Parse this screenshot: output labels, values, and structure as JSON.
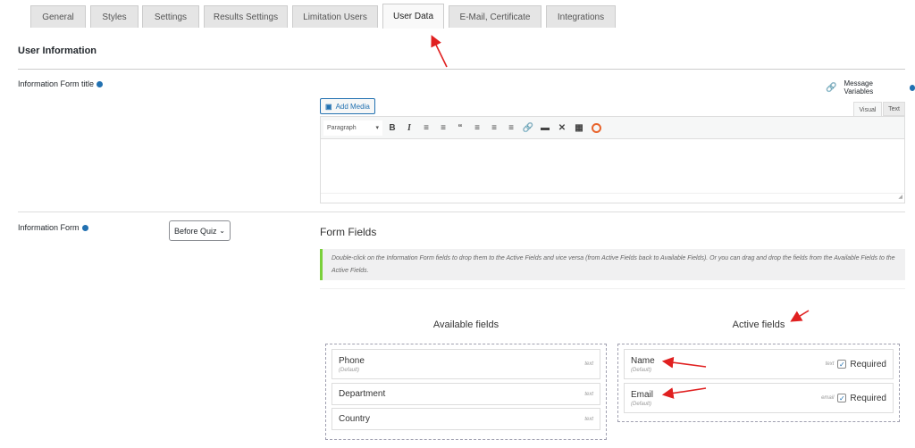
{
  "tabs": [
    "General",
    "Styles",
    "Settings",
    "Results Settings",
    "Limitation Users",
    "User Data",
    "E-Mail, Certificate",
    "Integrations"
  ],
  "section_title": "User Information",
  "form_title_label": "Information Form title",
  "message_variables": "Message Variables",
  "add_media": "Add Media",
  "editor_tabs": {
    "visual": "Visual",
    "text": "Text"
  },
  "paragraph_select": "Paragraph",
  "info_form_label": "Information Form",
  "info_form_select": "Before Quiz",
  "form_fields_title": "Form Fields",
  "notice": "Double-click on the Information Form fields to drop them to the Active Fields and vice versa (from Active Fields back to Available Fields). Or you can drag and drop the fields from the Available Fields to the Active Fields.",
  "available_title": "Available fields",
  "active_title": "Active fields",
  "available_fields": [
    {
      "name": "Phone",
      "sub": "(Default)",
      "type": "text"
    },
    {
      "name": "Department",
      "sub": "",
      "type": "text"
    },
    {
      "name": "Country",
      "sub": "",
      "type": "text"
    }
  ],
  "active_fields": [
    {
      "name": "Name",
      "sub": "(Default)",
      "type": "text",
      "required": "Required"
    },
    {
      "name": "Email",
      "sub": "(Default)",
      "type": "email",
      "required": "Required"
    }
  ],
  "colors": {
    "accent": "#2271b1",
    "notice_border": "#7ad03a",
    "arrow": "#e02020"
  }
}
